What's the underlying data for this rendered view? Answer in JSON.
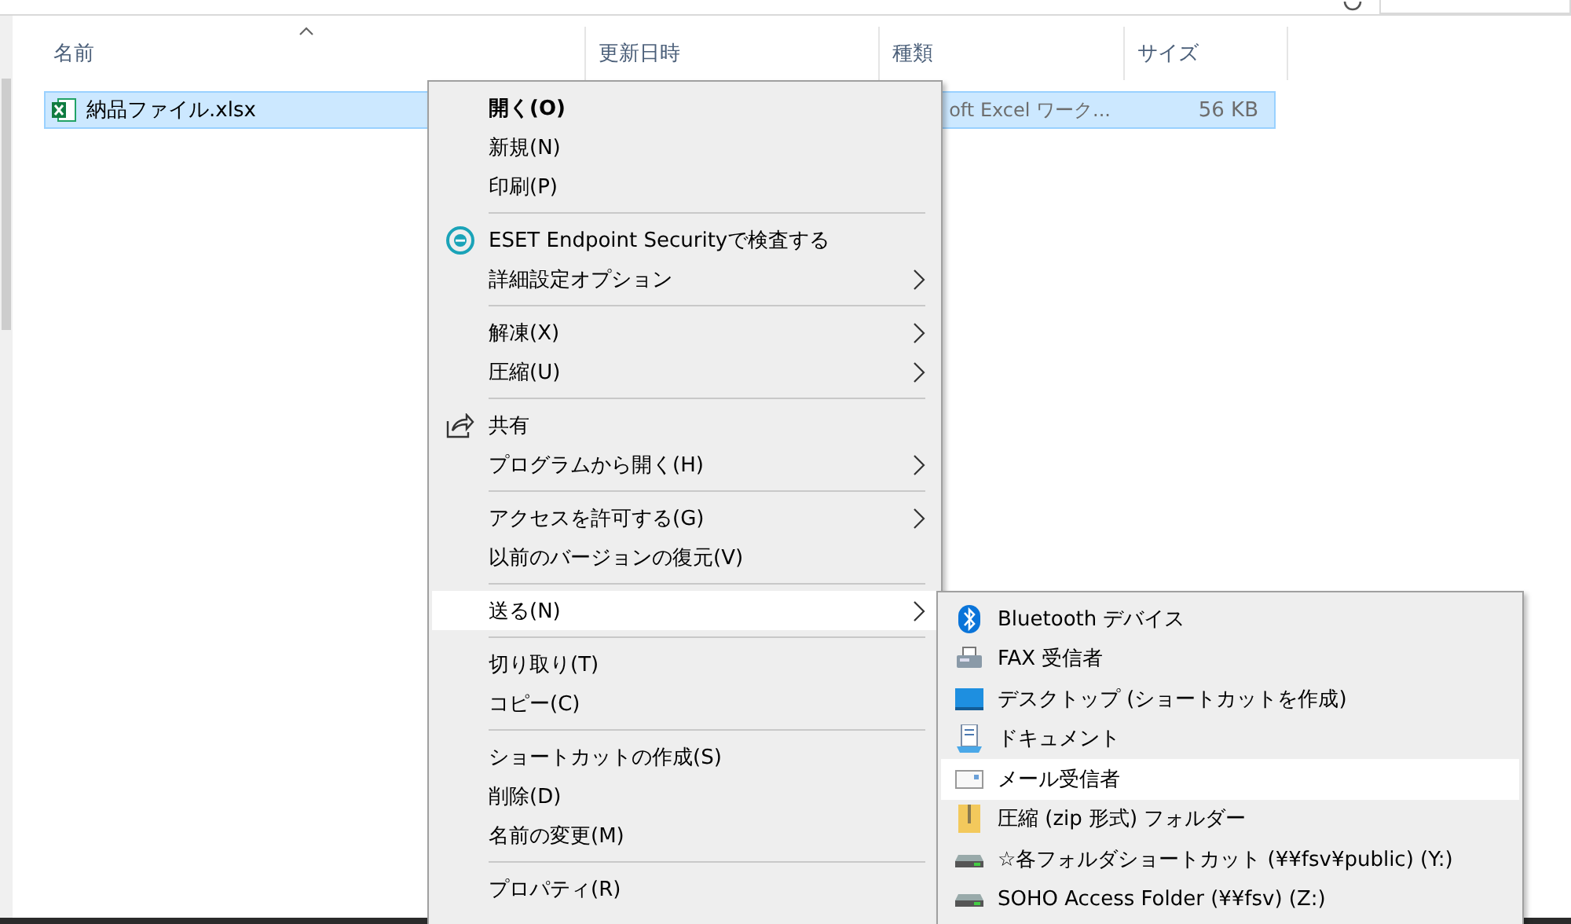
{
  "columns": [
    {
      "label": "名前",
      "sorted": true
    },
    {
      "label": "更新日時",
      "sorted": false
    },
    {
      "label": "種類",
      "sorted": false
    },
    {
      "label": "サイズ",
      "sorted": false
    }
  ],
  "file": {
    "name": "納品ファイル.xlsx",
    "type": "oft Excel ワーク...",
    "size": "56 KB",
    "selected": true
  },
  "menu": {
    "items": [
      {
        "kind": "item",
        "label": "開く(O)",
        "default": true,
        "submenu": false,
        "selected": false
      },
      {
        "kind": "item",
        "label": "新規(N)",
        "default": false,
        "submenu": false,
        "selected": false
      },
      {
        "kind": "item",
        "label": "印刷(P)",
        "default": false,
        "submenu": false,
        "selected": false
      },
      {
        "kind": "separator"
      },
      {
        "kind": "item",
        "label": "ESET Endpoint Securityで検査する",
        "default": false,
        "submenu": false,
        "selected": false
      },
      {
        "kind": "item",
        "label": "詳細設定オプション",
        "default": false,
        "submenu": true,
        "selected": false
      },
      {
        "kind": "separator"
      },
      {
        "kind": "item",
        "label": "解凍(X)",
        "default": false,
        "submenu": true,
        "selected": false
      },
      {
        "kind": "item",
        "label": "圧縮(U)",
        "default": false,
        "submenu": true,
        "selected": false
      },
      {
        "kind": "separator"
      },
      {
        "kind": "item",
        "label": "共有",
        "default": false,
        "submenu": false,
        "selected": false
      },
      {
        "kind": "item",
        "label": "プログラムから開く(H)",
        "default": false,
        "submenu": true,
        "selected": false
      },
      {
        "kind": "separator"
      },
      {
        "kind": "item",
        "label": "アクセスを許可する(G)",
        "default": false,
        "submenu": true,
        "selected": false
      },
      {
        "kind": "item",
        "label": "以前のバージョンの復元(V)",
        "default": false,
        "submenu": false,
        "selected": false
      },
      {
        "kind": "separator"
      },
      {
        "kind": "item",
        "label": "送る(N)",
        "default": false,
        "submenu": true,
        "selected": true
      },
      {
        "kind": "separator"
      },
      {
        "kind": "item",
        "label": "切り取り(T)",
        "default": false,
        "submenu": false,
        "selected": false
      },
      {
        "kind": "item",
        "label": "コピー(C)",
        "default": false,
        "submenu": false,
        "selected": false
      },
      {
        "kind": "separator"
      },
      {
        "kind": "item",
        "label": "ショートカットの作成(S)",
        "default": false,
        "submenu": false,
        "selected": false
      },
      {
        "kind": "item",
        "label": "削除(D)",
        "default": false,
        "submenu": false,
        "selected": false
      },
      {
        "kind": "item",
        "label": "名前の変更(M)",
        "default": false,
        "submenu": false,
        "selected": false
      },
      {
        "kind": "separator"
      },
      {
        "kind": "item",
        "label": "プロパティ(R)",
        "default": false,
        "submenu": false,
        "selected": false
      }
    ]
  },
  "send_to": {
    "items": [
      {
        "label": "Bluetooth デバイス",
        "selected": false
      },
      {
        "label": "FAX 受信者",
        "selected": false
      },
      {
        "label": "デスクトップ (ショートカットを作成)",
        "selected": false
      },
      {
        "label": "ドキュメント",
        "selected": false
      },
      {
        "label": "メール受信者",
        "selected": true
      },
      {
        "label": "圧縮 (zip 形式) フォルダー",
        "selected": false
      },
      {
        "label": "☆各フォルダショートカット (¥¥fsv¥public) (Y:)",
        "selected": false
      },
      {
        "label": "SOHO Access Folder (¥¥fsv) (Z:)",
        "selected": false
      }
    ]
  }
}
